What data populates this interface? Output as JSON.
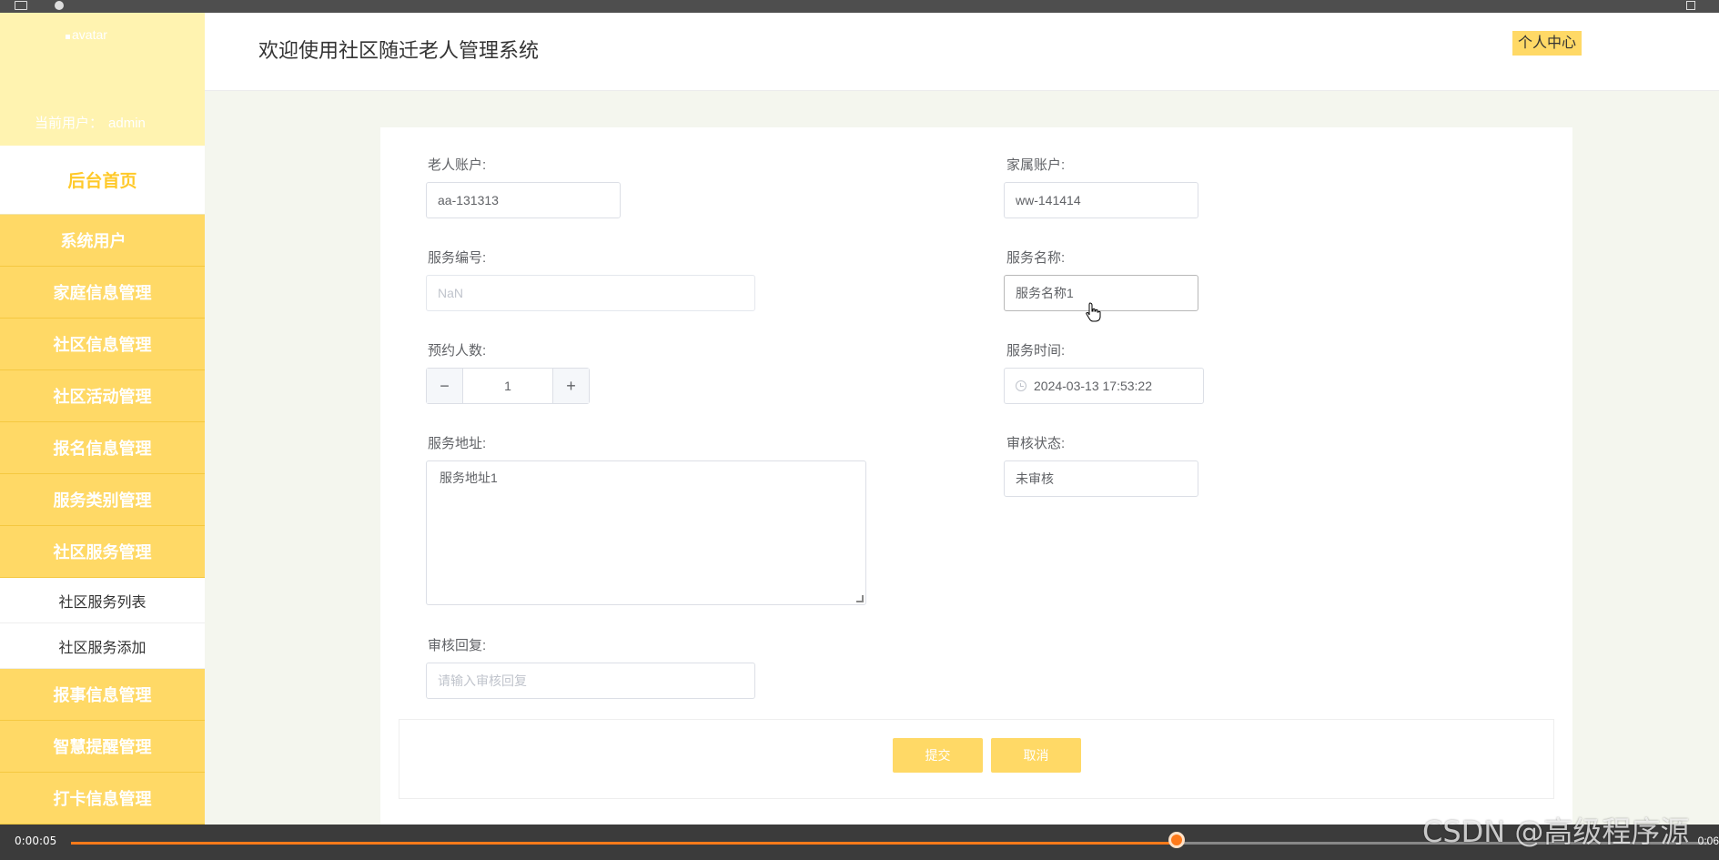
{
  "sidebar": {
    "avatar_alt": "avatar",
    "current_user_label": "当前用户：",
    "current_user": "admin",
    "home": "后台首页",
    "items": [
      "系统用户",
      "家庭信息管理",
      "社区信息管理",
      "社区活动管理",
      "报名信息管理",
      "服务类别管理",
      "社区服务管理"
    ],
    "sub_items": [
      "社区服务列表",
      "社区服务添加"
    ],
    "items_after": [
      "报事信息管理",
      "智慧提醒管理",
      "打卡信息管理"
    ]
  },
  "header": {
    "title": "欢迎使用社区随迁老人管理系统",
    "personal_center": "个人中心"
  },
  "form": {
    "elder_account_label": "老人账户:",
    "elder_account": "aa-131313",
    "family_account_label": "家属账户:",
    "family_account": "ww-141414",
    "service_no_label": "服务编号:",
    "service_no": "NaN",
    "service_name_label": "服务名称:",
    "service_name": "服务名称1",
    "booking_count_label": "预约人数:",
    "booking_count": "1",
    "service_time_label": "服务时间:",
    "service_time": "2024-03-13 17:53:22",
    "service_address_label": "服务地址:",
    "service_address": "服务地址1",
    "review_status_label": "审核状态:",
    "review_status": "未审核",
    "review_reply_label": "审核回复:",
    "review_reply_placeholder": "请输入审核回复",
    "submit": "提交",
    "cancel": "取消"
  },
  "player": {
    "current_time": "0:00:05",
    "end_time_fragment": "0:06",
    "progress": 0.675
  },
  "watermark": "CSDN @高级程序源",
  "colors": {
    "accent": "#ffd966",
    "sidebar_header": "#fff3b0",
    "home_text": "#ffc929",
    "progress": "#ff7a1a"
  }
}
